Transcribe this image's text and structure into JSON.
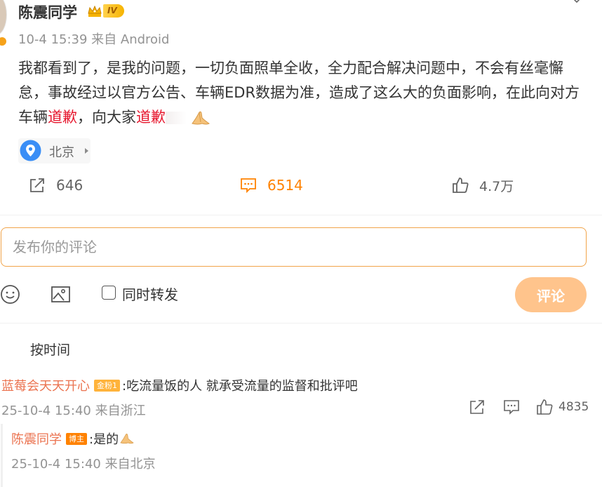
{
  "post": {
    "author": "陈震同学",
    "level_badge": "IV",
    "time_source": "10-4 15:39 来自 Android",
    "content": {
      "text_1": "我都看到了，是我的问题，一切负面照单全收，全力配合解决问题中，不会有丝毫懈怠，事故经过以官方公告、车辆EDR数据为准，造成了这么大的负面影响，在此向对方车辆",
      "keyword_1": "道歉",
      "text_2": "，向大家",
      "keyword_2": "道歉"
    },
    "location": "北京",
    "stats": {
      "reposts": "646",
      "comments": "6514",
      "likes": "4.7万"
    }
  },
  "composer": {
    "placeholder": "发布你的评论",
    "repost_label": "同时转发",
    "submit_label": "评论"
  },
  "sort": {
    "label": "按时间"
  },
  "comments": [
    {
      "user": "蓝莓会天天开心",
      "badge": "金粉1",
      "text": ":吃流量饭的人 就承受流量的监督和批评吧",
      "meta": "25-10-4 15:40 来自浙江",
      "likes": "4835"
    },
    {
      "user": "陈震同学",
      "badge": "博主",
      "text": ":是的",
      "meta": "25-10-4 15:40 来自北京"
    }
  ],
  "icons": {
    "crown": "crown-icon",
    "location": "location-pin-icon",
    "repost": "share-icon",
    "comment": "comment-icon",
    "like": "thumbs-up-icon",
    "emoji": "emoji-icon",
    "image": "image-icon",
    "pray": "praying-hands-emoji"
  },
  "colors": {
    "accent_orange": "#ff8200",
    "keyword_red": "#e6162d",
    "username": "#eb7350",
    "submit_button": "#ffc48c",
    "input_border": "#f1a44a"
  }
}
